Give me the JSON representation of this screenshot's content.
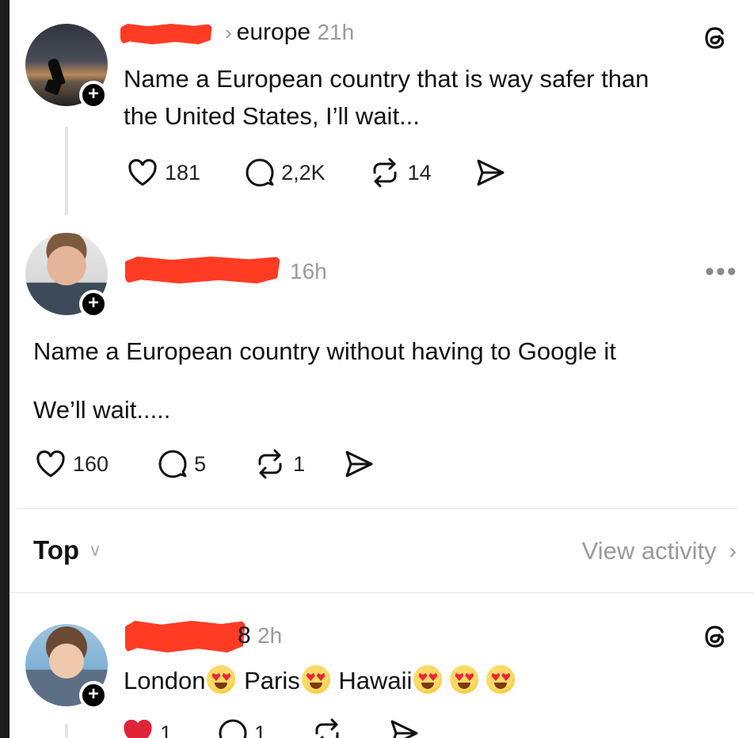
{
  "post1": {
    "community": "europe",
    "time": "21h",
    "text_line1": "Name a European country that is way safer than",
    "text_line2": "the United States, I’ll wait...",
    "likes": "181",
    "replies": "2,2K",
    "reposts": "14"
  },
  "post2": {
    "time": "16h",
    "more": "•••",
    "text_line1": "Name a European country without having to Google it",
    "text_line2": "We’ll wait.....",
    "likes": "160",
    "replies": "5",
    "reposts": "1"
  },
  "feed_controls": {
    "sort_label": "Top",
    "view_activity_label": "View activity"
  },
  "reply1": {
    "username_visible_suffix": "8",
    "time": "2h",
    "word1": "London",
    "word2": "Paris",
    "word3": "Hawaii",
    "likes": "1",
    "replies": "1"
  },
  "icons": {
    "follow": "plus-icon",
    "like": "heart-icon",
    "reply": "comment-icon",
    "repost": "repost-icon",
    "share": "send-icon",
    "app": "threads-logo-icon",
    "emoji": "heart-eyes-emoji"
  },
  "colors": {
    "redaction": "#ff3b24",
    "liked_heart": "#e0243a",
    "muted_text": "#9a9a9a"
  }
}
